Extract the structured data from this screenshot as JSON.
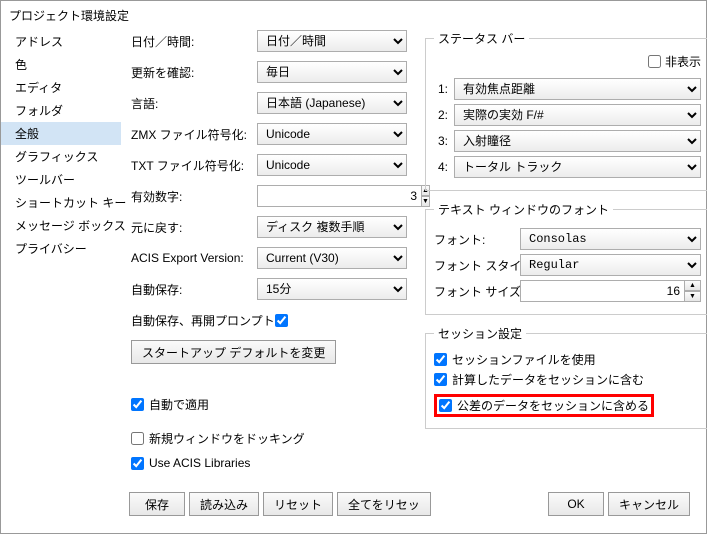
{
  "title": "プロジェクト環境設定",
  "sidebar": {
    "items": [
      {
        "label": "アドレス"
      },
      {
        "label": "色"
      },
      {
        "label": "エディタ"
      },
      {
        "label": "フォルダ"
      },
      {
        "label": "全般"
      },
      {
        "label": "グラフィックス"
      },
      {
        "label": "ツールバー"
      },
      {
        "label": "ショートカット キー"
      },
      {
        "label": "メッセージ ボックス"
      },
      {
        "label": "プライバシー"
      }
    ]
  },
  "form": {
    "datetime_label": "日付／時間:",
    "datetime_value": "日付／時間",
    "updates_label": "更新を確認:",
    "updates_value": "毎日",
    "lang_label": "言語:",
    "lang_value": "日本語 (Japanese)",
    "zmx_label": "ZMX ファイル符号化:",
    "zmx_value": "Unicode",
    "txt_label": "TXT ファイル符号化:",
    "txt_value": "Unicode",
    "sigdig_label": "有効数字:",
    "sigdig_value": "3",
    "revert_label": "元に戻す:",
    "revert_value": "ディスク 複数手順",
    "acis_label": "ACIS Export Version:",
    "acis_value": "Current (V30)",
    "autosave_label": "自動保存:",
    "autosave_value": "15分",
    "reopen_label": "自動保存、再開プロンプト:",
    "startup_btn": "スタートアップ デフォルトを変更",
    "autoapply": "自動で適用",
    "dock": "新規ウィンドウをドッキング",
    "use_acis": "Use ACIS Libraries"
  },
  "statusbar": {
    "legend": "ステータス バー",
    "hide": "非表示",
    "rows": [
      {
        "n": "1:",
        "v": "有効焦点距離"
      },
      {
        "n": "2:",
        "v": "実際の実効 F/#"
      },
      {
        "n": "3:",
        "v": "入射瞳径"
      },
      {
        "n": "4:",
        "v": "トータル トラック"
      }
    ]
  },
  "font": {
    "legend": "テキスト ウィンドウのフォント",
    "font_label": "フォント:",
    "font_value": "Consolas",
    "style_label": "フォント スタイル:",
    "style_value": "Regular",
    "size_label": "フォント サイズ:",
    "size_value": "16"
  },
  "session": {
    "legend": "セッション設定",
    "use_file": "セッションファイルを使用",
    "include_calc": "計算したデータをセッションに含む",
    "include_tol": "公差のデータをセッションに含める"
  },
  "footer": {
    "save": "保存",
    "load": "読み込み",
    "reset": "リセット",
    "reset_all": "全てをリセッ",
    "ok": "OK",
    "cancel": "キャンセル"
  }
}
